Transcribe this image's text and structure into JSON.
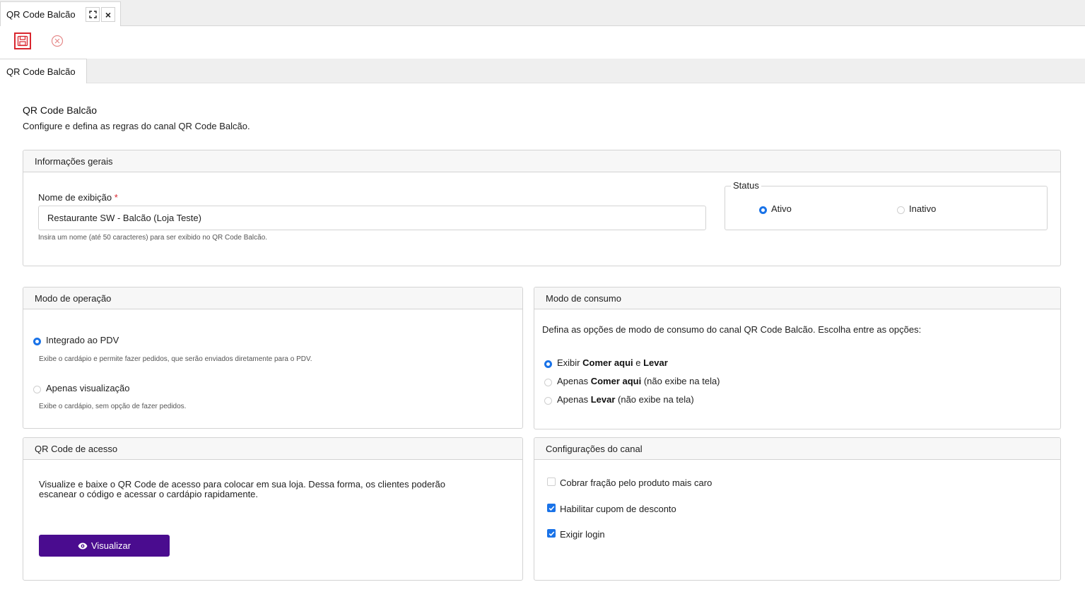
{
  "window_tab": {
    "title": "QR Code Balcão",
    "expand_icon": "expand-icon",
    "close_label": "×"
  },
  "toolbar": {
    "save_icon": "save-icon",
    "cancel_icon": "cancel-circle-icon"
  },
  "inner_tabs": [
    {
      "label": "QR Code Balcão"
    }
  ],
  "page": {
    "title": "QR Code Balcão",
    "subtitle": "Configure e defina as regras do canal QR Code Balcão."
  },
  "general_info": {
    "header": "Informações gerais",
    "display_name_label": "Nome de exibição",
    "required_mark": "*",
    "display_name_value": "Restaurante SW - Balcão (Loja Teste)",
    "display_name_help": "Insira um nome (até 50 caracteres) para ser exibido no QR Code Balcão.",
    "status": {
      "legend": "Status",
      "options": [
        {
          "label": "Ativo",
          "selected": true
        },
        {
          "label": "Inativo",
          "selected": false
        }
      ]
    }
  },
  "operation_mode": {
    "header": "Modo de operação",
    "options": [
      {
        "label": "Integrado ao PDV",
        "help": "Exibe o cardápio e permite fazer pedidos, que serão enviados diretamente para o PDV.",
        "selected": true
      },
      {
        "label": "Apenas visualização",
        "help": "Exibe o cardápio, sem opção de fazer pedidos.",
        "selected": false
      }
    ]
  },
  "consumption_mode": {
    "header": "Modo de consumo",
    "description": "Defina as opções de modo de consumo do canal QR Code Balcão. Escolha entre as opções:",
    "options": [
      {
        "pre": "Exibir ",
        "b1": "Comer aqui",
        "mid": " e ",
        "b2": "Levar",
        "post": "",
        "selected": true
      },
      {
        "pre": "Apenas ",
        "b1": "Comer aqui",
        "mid": " (não exibe na tela)",
        "b2": "",
        "post": "",
        "selected": false
      },
      {
        "pre": "Apenas ",
        "b1": "Levar",
        "mid": " (não exibe na tela)",
        "b2": "",
        "post": "",
        "selected": false
      }
    ]
  },
  "access_qr": {
    "header": "QR Code de acesso",
    "description_line1": "Visualize e baixe o QR Code de acesso para colocar em sua loja. Dessa forma, os clientes poderão",
    "description_line2": "escanear o código e acessar o cardápio rapidamente.",
    "button_label": "Visualizar",
    "button_icon": "eye-icon"
  },
  "channel_settings": {
    "header": "Configurações do canal",
    "options": [
      {
        "label": "Cobrar fração pelo produto mais caro",
        "checked": false
      },
      {
        "label": "Habilitar cupom de desconto",
        "checked": true
      },
      {
        "label": "Exigir login",
        "checked": true
      }
    ]
  },
  "colors": {
    "accent": "#1a73e8",
    "primary_button": "#4a0c8f",
    "save_border": "#d9262e",
    "cancel_icon": "#e58a8a"
  }
}
